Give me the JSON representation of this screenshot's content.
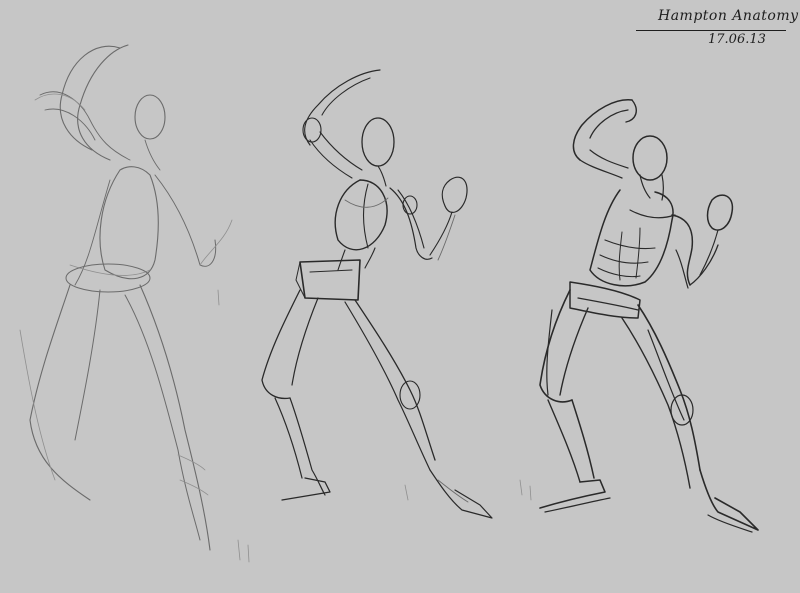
{
  "caption": {
    "title": "Hampton Anatomy",
    "date": "17.06.13"
  },
  "colors": {
    "background": "#c6c6c6",
    "ink": "#2a2a2a",
    "construction": "#6b6b6b"
  }
}
